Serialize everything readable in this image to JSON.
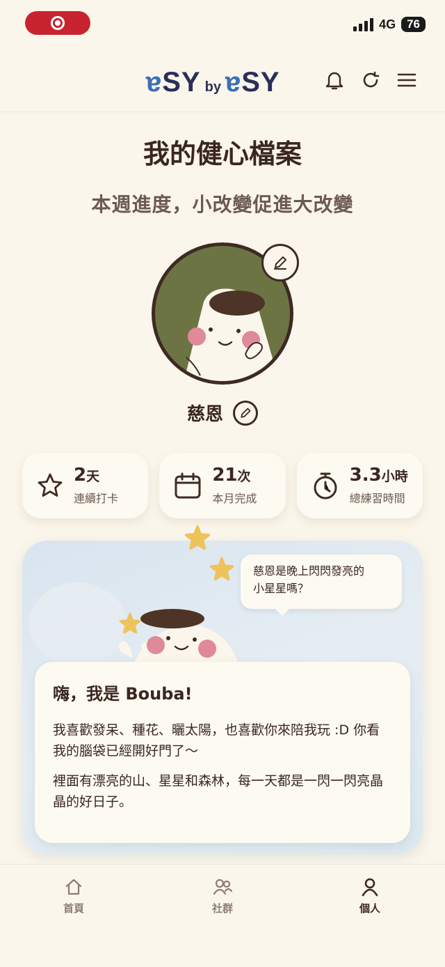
{
  "status_bar": {
    "network": "4G",
    "battery": "76"
  },
  "header": {
    "logo_left": "SY",
    "logo_by": "by",
    "logo_right": "SY",
    "icons": [
      "bell-icon",
      "refresh-icon",
      "menu-icon"
    ]
  },
  "page": {
    "title": "我的健心檔案",
    "subtitle": "本週進度，小改變促進大改變"
  },
  "profile": {
    "name": "慈恩"
  },
  "stats": [
    {
      "icon": "star-icon",
      "value": "2",
      "unit": "天",
      "label": "連續打卡"
    },
    {
      "icon": "calendar-icon",
      "value": "21",
      "unit": "次",
      "label": "本月完成"
    },
    {
      "icon": "stopwatch-icon",
      "value": "3.3",
      "unit": "小時",
      "label": "總練習時間"
    }
  ],
  "bouba": {
    "speech_line1": "慈恩是晚上閃閃發亮的",
    "speech_line2": "小星星嗎？",
    "title": "嗨，我是 Bouba!",
    "para1": "我喜歡發呆、種花、曬太陽，也喜歡你來陪我玩 :D 你看我的腦袋已經開好門了～",
    "para2": "裡面有漂亮的山、星星和森林，每一天都是一閃一閃亮晶晶的好日子。"
  },
  "nav": [
    {
      "icon": "home-icon",
      "label": "首頁"
    },
    {
      "icon": "community-icon",
      "label": "社群"
    },
    {
      "icon": "person-icon",
      "label": "個人",
      "active": true
    }
  ],
  "colors": {
    "background": "#fbf6eb",
    "text": "#3d2a22",
    "accent_blue": "#3b6fb8",
    "avatar_green": "#6c7444",
    "record": "#c8242f"
  }
}
